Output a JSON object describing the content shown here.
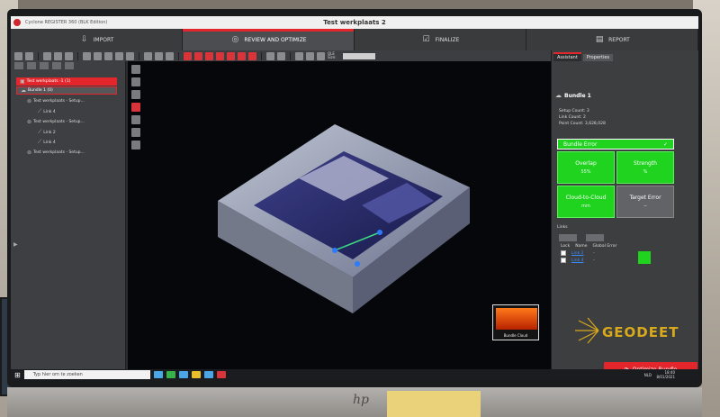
{
  "window": {
    "app_name": "Cyclone REGISTER 360 (BLK Edition)",
    "project_title": "Test werkplaats 2"
  },
  "workflow": {
    "steps": [
      {
        "label": "IMPORT",
        "icon": "import-icon"
      },
      {
        "label": "REVIEW AND OPTIMIZE",
        "icon": "review-icon"
      },
      {
        "label": "FINALIZE",
        "icon": "finalize-icon"
      },
      {
        "label": "REPORT",
        "icon": "report-icon"
      }
    ],
    "active": "REVIEW AND OPTIMIZE"
  },
  "toolbar": {
    "qs_label": "QLE Size:"
  },
  "tree": {
    "project": "Test werkplaats -1 (1)",
    "bundle": "Bundle 1 (0)",
    "items": [
      "Test werkplaats - Setup...",
      "Link 4",
      "Test werkplaats - Setup...",
      "Link 2",
      "Link 4",
      "Test werkplaats - Setup..."
    ]
  },
  "viewport": {
    "thumbnail_label": "Bundle Cloud"
  },
  "panel": {
    "tabs": [
      "Assistant",
      "Properties"
    ],
    "active_tab": "Assistant",
    "title": "Bundle 1",
    "setup_count": "Setup Count: 3",
    "link_count": "Link Count: 2",
    "point_count": "Point Count: 3,628,028",
    "bundle_error_label": "Bundle Error",
    "metrics": [
      {
        "label": "Overlap",
        "value": "55%",
        "status": "green"
      },
      {
        "label": "Strength",
        "value": "%",
        "status": "green"
      },
      {
        "label": "Cloud-to-Cloud",
        "value": "mm",
        "status": "green"
      },
      {
        "label": "Target Error",
        "value": "--",
        "status": "grey"
      }
    ],
    "links_label": "Links",
    "links_headers": [
      "Lock",
      "Name",
      "Global Error"
    ],
    "links": [
      {
        "name": "Link 2",
        "error": "-"
      },
      {
        "name": "Link 4",
        "error": "-"
      }
    ],
    "logo_text": "GEODEET",
    "optimize_label": "Optimize Bundle"
  },
  "taskbar": {
    "search_placeholder": "Typ hier om te zoeken",
    "time": "18:40",
    "date": "8/01/2021",
    "lang": "NLD"
  },
  "colors": {
    "accent_red": "#e3262b",
    "success_green": "#1fd31f",
    "panel_bg": "#3d3e40"
  }
}
